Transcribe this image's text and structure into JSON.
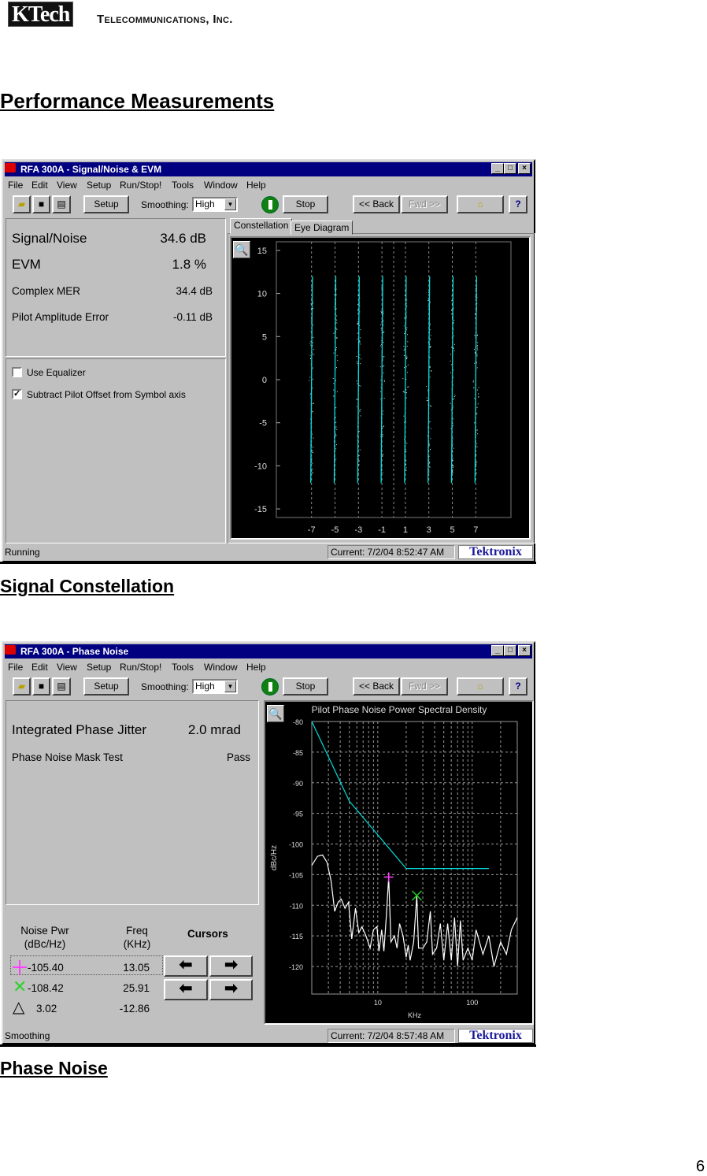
{
  "header": {
    "logo_text": "KTech",
    "company": "Telecommunications, Inc."
  },
  "page_title": "Performance Measurements",
  "page_number": "6",
  "common": {
    "menu": [
      "File",
      "Edit",
      "View",
      "Setup",
      "Run/Stop!",
      "Tools",
      "Window",
      "Help"
    ],
    "toolbar": {
      "setup": "Setup",
      "smoothing_label": "Smoothing:",
      "smoothing_value": "High",
      "stop": "Stop",
      "back": "<< Back",
      "fwd": "Fwd >>"
    },
    "brand": "Tektronix",
    "colors": {
      "titlebar": "#000080",
      "trace_cyan": "#00e0e0",
      "cursor1": "#ff40ff",
      "cursor2": "#20d020"
    }
  },
  "window1": {
    "title": "RFA 300A - Signal/Noise & EVM",
    "measurements": [
      {
        "label": "Signal/Noise",
        "value": "34.6 dB"
      },
      {
        "label": "EVM",
        "value": "1.8 %"
      },
      {
        "label": "Complex MER",
        "value": "34.4 dB"
      },
      {
        "label": "Pilot Amplitude Error",
        "value": "-0.11 dB"
      }
    ],
    "options": [
      {
        "label": "Use Equalizer",
        "checked": false
      },
      {
        "label": "Subtract Pilot Offset from Symbol axis",
        "checked": true
      }
    ],
    "tabs": [
      {
        "label": "Constellation",
        "selected": true
      },
      {
        "label": "Eye Diagram",
        "selected": false
      }
    ],
    "status": "Running",
    "current": "Current: 7/2/04 8:52:47 AM",
    "caption": "Signal Constellation"
  },
  "window2": {
    "title": "RFA 300A - Phase Noise",
    "jitter_label": "Integrated Phase Jitter",
    "jitter_value": "2.0 mrad",
    "mask_label": "Phase Noise Mask Test",
    "mask_value": "Pass",
    "cursors": {
      "col1": [
        "Noise Pwr",
        "(dBc/Hz)"
      ],
      "col2": [
        "Freq",
        "(KHz)"
      ],
      "title": "Cursors",
      "rows": [
        {
          "marker": "plus",
          "power": "-105.40",
          "freq": "13.05"
        },
        {
          "marker": "x",
          "power": "-108.42",
          "freq": "25.91"
        },
        {
          "marker": "delta",
          "power": "3.02",
          "freq": "-12.86"
        }
      ]
    },
    "status": "Smoothing",
    "current": "Current: 7/2/04 8:57:48 AM",
    "caption": "Phase Noise"
  },
  "chart_data": [
    {
      "type": "scatter",
      "title": "",
      "xlim": [
        -10,
        10
      ],
      "ylim": [
        -16,
        16
      ],
      "xticks": [
        -7,
        -5,
        -3,
        -1,
        1,
        3,
        5,
        7
      ],
      "yticks": [
        15,
        10,
        5,
        0,
        -5,
        -10,
        -15
      ],
      "symbol_columns": [
        -7,
        -5,
        -3,
        -1,
        1,
        3,
        5,
        7
      ],
      "column_extent": [
        -12,
        12
      ],
      "grid": "vertical dashed at symbol columns"
    },
    {
      "type": "line",
      "title": "Pilot Phase Noise Power Spectral Density",
      "xlabel": "KHz",
      "ylabel": "dBc/Hz",
      "xscale": "log",
      "xlim": [
        2,
        300
      ],
      "ylim": [
        -124.5,
        -80
      ],
      "xticks": [
        10,
        100
      ],
      "yticks": [
        -80,
        -85,
        -90,
        -95,
        -100,
        -105,
        -110,
        -115,
        -120
      ],
      "grid": true,
      "series": [
        {
          "role": "mask",
          "color": "#00e0e0",
          "points": [
            [
              2,
              -80
            ],
            [
              5,
              -93
            ],
            [
              20,
              -104
            ],
            [
              150,
              -104
            ]
          ]
        },
        {
          "role": "measured",
          "color": "#ffffff",
          "points": [
            [
              2,
              -103.5
            ],
            [
              2.3,
              -102
            ],
            [
              2.6,
              -101.8
            ],
            [
              2.9,
              -103
            ],
            [
              3.2,
              -106
            ],
            [
              3.5,
              -111
            ],
            [
              3.8,
              -109.5
            ],
            [
              4.1,
              -109
            ],
            [
              4.5,
              -110.5
            ],
            [
              4.9,
              -109.5
            ],
            [
              5.3,
              -115.5
            ],
            [
              5.8,
              -110.5
            ],
            [
              6.3,
              -114.5
            ],
            [
              6.8,
              -113.5
            ],
            [
              7.5,
              -115
            ],
            [
              8.3,
              -117
            ],
            [
              9,
              -114
            ],
            [
              9.8,
              -113.5
            ],
            [
              10.3,
              -117.5
            ],
            [
              11,
              -114
            ],
            [
              11.6,
              -117.5
            ],
            [
              12.3,
              -112
            ],
            [
              13.05,
              -105.4
            ],
            [
              13.8,
              -116
            ],
            [
              15,
              -115
            ],
            [
              16,
              -117
            ],
            [
              17,
              -113
            ],
            [
              18.5,
              -115
            ],
            [
              20,
              -118.5
            ],
            [
              21,
              -116.5
            ],
            [
              22,
              -119
            ],
            [
              24,
              -116
            ],
            [
              25.91,
              -108.4
            ],
            [
              27,
              -117
            ],
            [
              30,
              -117
            ],
            [
              33,
              -116
            ],
            [
              36,
              -111
            ],
            [
              38,
              -118
            ],
            [
              42,
              -117
            ],
            [
              46,
              -113
            ],
            [
              50,
              -119
            ],
            [
              55,
              -113
            ],
            [
              60,
              -119
            ],
            [
              65,
              -112
            ],
            [
              70,
              -120
            ],
            [
              75,
              -112.5
            ],
            [
              80,
              -119
            ],
            [
              90,
              -117
            ],
            [
              100,
              -119
            ],
            [
              110,
              -114
            ],
            [
              130,
              -118
            ],
            [
              150,
              -115
            ],
            [
              170,
              -120
            ],
            [
              200,
              -116
            ],
            [
              230,
              -118
            ],
            [
              260,
              -114
            ],
            [
              300,
              -112
            ]
          ]
        }
      ],
      "cursors": [
        {
          "marker": "plus",
          "x": 13.05,
          "y": -105.4,
          "color": "#ff40ff"
        },
        {
          "marker": "x",
          "x": 25.91,
          "y": -108.42,
          "color": "#20d020"
        }
      ]
    }
  ]
}
